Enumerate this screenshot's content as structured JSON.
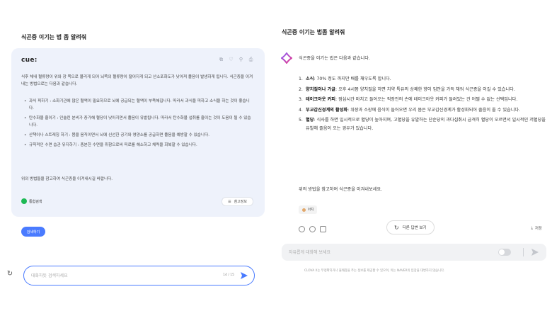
{
  "left": {
    "title": "식곤증 이기는 법 좀 알려줘",
    "brand": "cue:",
    "intro": "식후 체내 혈류량이 위와 장 쪽으로 몰리게 되어 뇌쪽의 혈류량이 떨어지게 되고 산소포화도가 낮아져 졸음이 발생하게 됩니다. 식곤증을 이겨내는 방법으로는 다음과 같습니다.",
    "bullets": [
      "과식 피하기 : 소화기관에 많은 혈액이 필요하므로 뇌에 공급되는 혈액이 부족해집니다. 따라서 과식을 피하고 소식을 하는 것이 좋습니다.",
      "탄수화물 줄이기 : 인슐린 분비가 증가해 혈당이 낮아지면서 졸음이 유발됩니다. 따라서 탄수화물 섭취를 줄이는 것이 도움이 될 수 있습니다.",
      "산책이나 스트레칭 하기 : 몸을 움직이면서 뇌에 신선한 공기와 영양소를 공급하면 졸음을 예방할 수 있습니다.",
      "규칙적인 수면 습관 유지하기 : 충분한 수면을 취함으로써 피로를 해소하고 체력을 회복할 수 있습니다."
    ],
    "outro": "위의 방법들을 참고하여 식곤증을 이겨내시길 바랍니다.",
    "source_label": "통합검색",
    "ref_label": "참고정보",
    "search_pill": "검색하기",
    "input_placeholder": "대화하듯 검색하세요",
    "counter": "14 / 15"
  },
  "right": {
    "title": "식곤증 이기는 법좀 알려줘",
    "intro": "식곤증을 이기는 법은 다음과 같습니다.",
    "items": [
      {
        "num": "1.",
        "head": "소식",
        "body": ": 70% 정도 까지만 배를 채우도록 합니다."
      },
      {
        "num": "2.",
        "head": "양치질이나 가글",
        "body": ": 오후 4시쯤 양치질을 하면 치약 특유의 상쾌한 향이 입안을 가득 채워 식곤증을 이길 수 있습니다."
      },
      {
        "num": "3.",
        "head": "테이크아웃 커피",
        "body": ": 점심시간 마치고 들어오는 직장인의 손에 테이크아웃 커피가 들려있는 건 어쩔 수 없는 선택입니다."
      },
      {
        "num": "4.",
        "head": "부교감신경계의 활성화",
        "body": ": 위장과 소장에 음식이 들어오면 우리 몸은 부교감신경계가 활성화되어 졸음이 올 수 있습니다."
      },
      {
        "num": "5.",
        "head": "혈당",
        "body": ": 식사를 하면 일시적으로 혈당이 높아지며, 고혈당을 유발하는 단순당의 과다섭취시 급격히 혈당이 오르면서 일시적인 저혈당을 유발해 졸음이 오는 경우가 있습니다."
      }
    ],
    "outro": "위의 방법을 참고하여 식곤증을 이겨내보세요.",
    "chip_label": "아지",
    "regen_label": "다른 답변 보기",
    "save_label": "저장",
    "input_placeholder": "자유롭게 대화해 보세요",
    "disclaimer": "CLOVA X는 부정확하거나 불쾌감을 주는 정보를 제공할 수 있으며, 이는 NAVER의 입장을 대변하지 않습니다."
  },
  "colors": {
    "accent": "#4a7bff",
    "card_bg": "#eef2fb",
    "clova_pink": "#e83a8c",
    "clova_purple": "#8a5cf6"
  },
  "icons": {
    "card_tools": [
      "copy-icon",
      "thumbs-up-icon",
      "pin-icon",
      "share-icon"
    ],
    "left_refresh": "refresh-icon",
    "left_send": "send-icon",
    "right_actions": [
      "thumbs-up-icon",
      "thumbs-down-icon",
      "copy-icon"
    ],
    "regen": "refresh-icon",
    "save": "save-icon"
  }
}
